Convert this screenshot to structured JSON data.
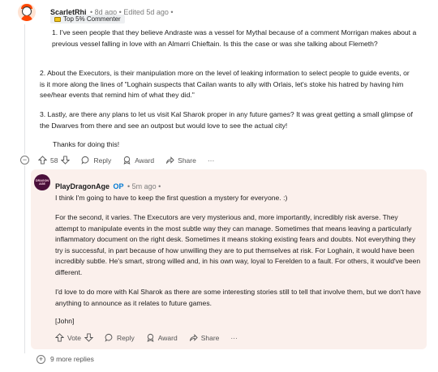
{
  "parent": {
    "username": "ScarletRhi",
    "meta": "• 8d ago • Edited 5d ago •",
    "flair": "Top 5% Commenter",
    "paragraphs": [
      "1. I've seen people that they believe Andraste was a vessel for Mythal because of a comment Morrigan makes about a previous vessel falling in love with an Almarri Chieftain. Is this the case or was she talking about Flemeth?",
      "2. About the Executors, is their manipulation more on the level of leaking information to select people to guide events, or is it more along the lines of \"Loghain suspects that Cailan wants to ally with Orlais, let's stoke his hatred by having him see/hear events that remind him of what they did.\"",
      "3. Lastly, are there any plans to let us visit Kal Sharok proper in any future games? It was great getting a small glimpse of the Dwarves from there and see an outpost but would love to see the actual city!",
      "Thanks for doing this!"
    ],
    "actions": {
      "vote_count": "58",
      "reply": "Reply",
      "award": "Award",
      "share": "Share",
      "more": "···"
    }
  },
  "reply": {
    "username": "PlayDragonAge",
    "op_tag": "OP",
    "meta": "• 5m ago •",
    "avatar_text": "DRAGON AGE",
    "paragraphs": [
      "I think I'm going to have to keep the first question a mystery for everyone. :)",
      "For the second, it varies. The Executors are very mysterious and, more importantly, incredibly risk averse. They attempt to manipulate events in the most subtle way they can manage. Sometimes that means leaving a particularly inflammatory document on the right desk. Sometimes it means stoking existing fears and doubts. Not everything they try is successful, in part because of how unwilling they are to put themselves at risk. For Loghain, it would have been incredibly subtle. He's smart, strong willed and, in his own way, loyal to Ferelden to a fault. For others, it would've been different.",
      "I'd love to do more with Kal Sharok as there are some interesting stories still to tell that involve them, but we don't have anything to announce as it relates to future games.",
      "[John]"
    ],
    "actions": {
      "vote": "Vote",
      "reply": "Reply",
      "award": "Award",
      "share": "Share",
      "more": "···"
    }
  },
  "more_replies": "9 more replies",
  "colors": {
    "op_accent": "#0079d3",
    "reply_background": "#fbf0ec",
    "flair_background": "#edeff1"
  }
}
